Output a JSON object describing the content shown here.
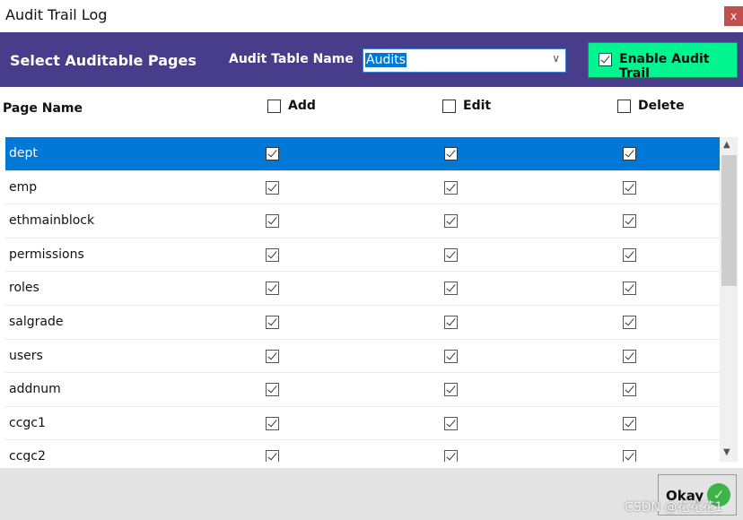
{
  "window": {
    "title": "Audit Trail Log",
    "close": "x"
  },
  "header": {
    "title": "Select Auditable Pages",
    "table_label": "Audit Table Name",
    "table_value": "Audits",
    "enable_label": "Enable Audit Trail",
    "enable_checked": true,
    "colors": {
      "header_bg": "#483d8b",
      "enable_bg": "#00f590"
    }
  },
  "columns": {
    "page_name": "Page Name",
    "add": "Add",
    "edit": "Edit",
    "delete": "Delete"
  },
  "rows": [
    {
      "name": "dept",
      "add": true,
      "edit": true,
      "delete": true,
      "selected": true
    },
    {
      "name": "emp",
      "add": true,
      "edit": true,
      "delete": true
    },
    {
      "name": "ethmainblock",
      "add": true,
      "edit": true,
      "delete": true
    },
    {
      "name": "permissions",
      "add": true,
      "edit": true,
      "delete": true
    },
    {
      "name": "roles",
      "add": true,
      "edit": true,
      "delete": true
    },
    {
      "name": "salgrade",
      "add": true,
      "edit": true,
      "delete": true
    },
    {
      "name": "users",
      "add": true,
      "edit": true,
      "delete": true
    },
    {
      "name": "addnum",
      "add": true,
      "edit": true,
      "delete": true
    },
    {
      "name": "ccgc1",
      "add": true,
      "edit": true,
      "delete": true
    },
    {
      "name": "ccgc2",
      "add": true,
      "edit": true,
      "delete": true
    }
  ],
  "footer": {
    "okay": "Okay"
  },
  "watermark": "CSDN @花花花1"
}
